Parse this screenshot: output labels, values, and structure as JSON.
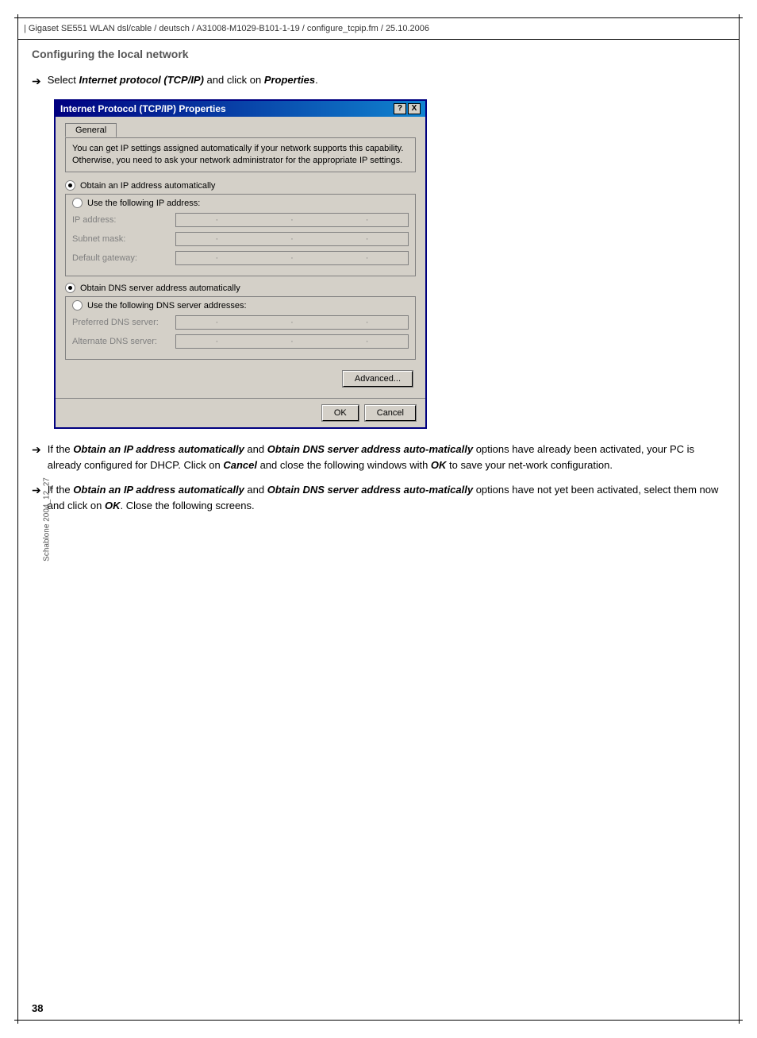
{
  "header": {
    "text": "| Gigaset SE551 WLAN dsl/cable / deutsch / A31008-M1029-B101-1-19 / configure_tcpip.fm / 25.10.2006"
  },
  "sidebar": {
    "label": "Schablone 2004_12_27"
  },
  "section": {
    "heading": "Configuring the local network"
  },
  "intro": {
    "text_prefix": "Select ",
    "bold_1": "Internet protocol (TCP/IP)",
    "text_mid": " and click on ",
    "bold_2": "Properties",
    "text_suffix": "."
  },
  "dialog": {
    "title": "Internet Protocol (TCP/IP) Properties",
    "titlebar_help": "?",
    "titlebar_close": "X",
    "tab_general": "General",
    "info_text": "You can get IP settings assigned automatically if your network supports this capability. Otherwise, you need to ask your network administrator for the appropriate IP settings.",
    "radio_auto_ip": "Obtain an IP address automatically",
    "radio_manual_ip": "Use the following IP address:",
    "field_ip_label": "IP address:",
    "field_subnet_label": "Subnet mask:",
    "field_gateway_label": "Default gateway:",
    "radio_auto_dns": "Obtain DNS server address automatically",
    "radio_manual_dns": "Use the following DNS server addresses:",
    "field_preferred_dns_label": "Preferred DNS server:",
    "field_alternate_dns_label": "Alternate DNS server:",
    "advanced_button": "Advanced...",
    "ok_button": "OK",
    "cancel_button": "Cancel"
  },
  "bullet1": {
    "arrow": "➔",
    "text_prefix": "If the ",
    "bold1": "Obtain an IP address automatically",
    "text_mid1": " and ",
    "bold2": "Obtain DNS server address auto-matically",
    "text_mid2": " options have already been activated, your PC is already configured for DHCP. Click on ",
    "bold3": "Cancel",
    "text_mid3": " and close the following windows with ",
    "bold4": "OK",
    "text_suffix": " to save your net-work configuration."
  },
  "bullet2": {
    "arrow": "➔",
    "text_prefix": "If the ",
    "bold1": "Obtain an IP address automatically",
    "text_mid1": " and ",
    "bold2": "Obtain DNS server address auto-matically",
    "text_mid2": " options have not yet been activated, select them now and click on ",
    "bold3": "OK",
    "text_suffix": ". Close the following screens."
  },
  "page_number": "38"
}
